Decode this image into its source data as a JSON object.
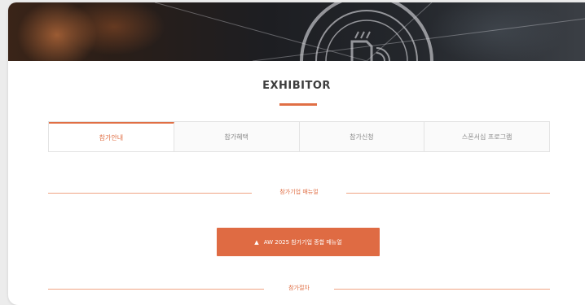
{
  "page": {
    "title": "EXHIBITOR"
  },
  "tabs": [
    {
      "label": "참가안내",
      "active": true
    },
    {
      "label": "참가혜택",
      "active": false
    },
    {
      "label": "참가신청",
      "active": false
    },
    {
      "label": "스폰서십 프로그램",
      "active": false
    }
  ],
  "section_manual": {
    "label": "참가기업 매뉴얼"
  },
  "download": {
    "label": "AW 2025 참가기업 종합 매뉴얼",
    "icon": "download-icon"
  },
  "section_apply": {
    "label": "참가절차"
  },
  "colors": {
    "accent": "#e06f45",
    "button": "#df6b43"
  }
}
